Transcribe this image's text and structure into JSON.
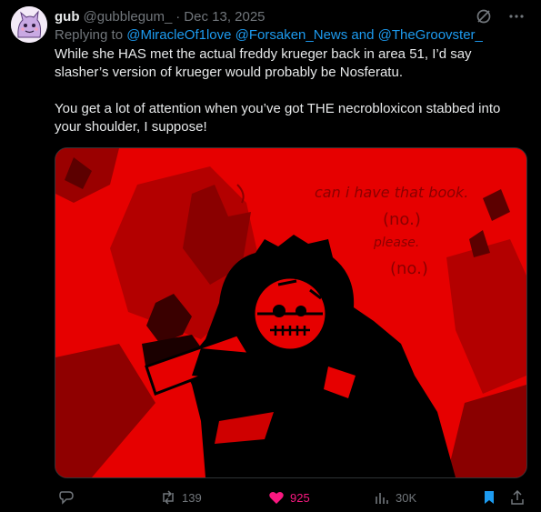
{
  "tweet": {
    "author_name": "gub",
    "author_handle": "@gubblegum_",
    "separator": "·",
    "date": "Dec 13, 2025",
    "replying_prefix": "Replying to",
    "replying_mentions": "@MiracleOf1love @Forsaken_News and @TheGroovster_",
    "body_paragraphs": [
      "While she HAS met the actual freddy krueger back in area 51, I’d say slasher’s version of krueger would probably be Nosferatu.",
      "You get a lot of attention when you’ve got THE necrobloxicon stabbed into your shoulder, I suppose!"
    ],
    "media": {
      "handwritten_lines": [
        "can i have that book.",
        "(no.)",
        "please.",
        "(no.)"
      ]
    },
    "actions": {
      "reply_count": "",
      "retweet_count": "139",
      "like_count": "925",
      "views_count": "30K"
    },
    "colors": {
      "accent": "#1d9bf0",
      "like": "#f91880",
      "muted": "#71767b",
      "text": "#e7e9ea",
      "image_red": "#e60000"
    },
    "icons": [
      "avatar",
      "grok-icon",
      "more-icon",
      "reply-icon",
      "retweet-icon",
      "like-icon",
      "views-icon",
      "bookmark-icon",
      "share-icon"
    ]
  }
}
